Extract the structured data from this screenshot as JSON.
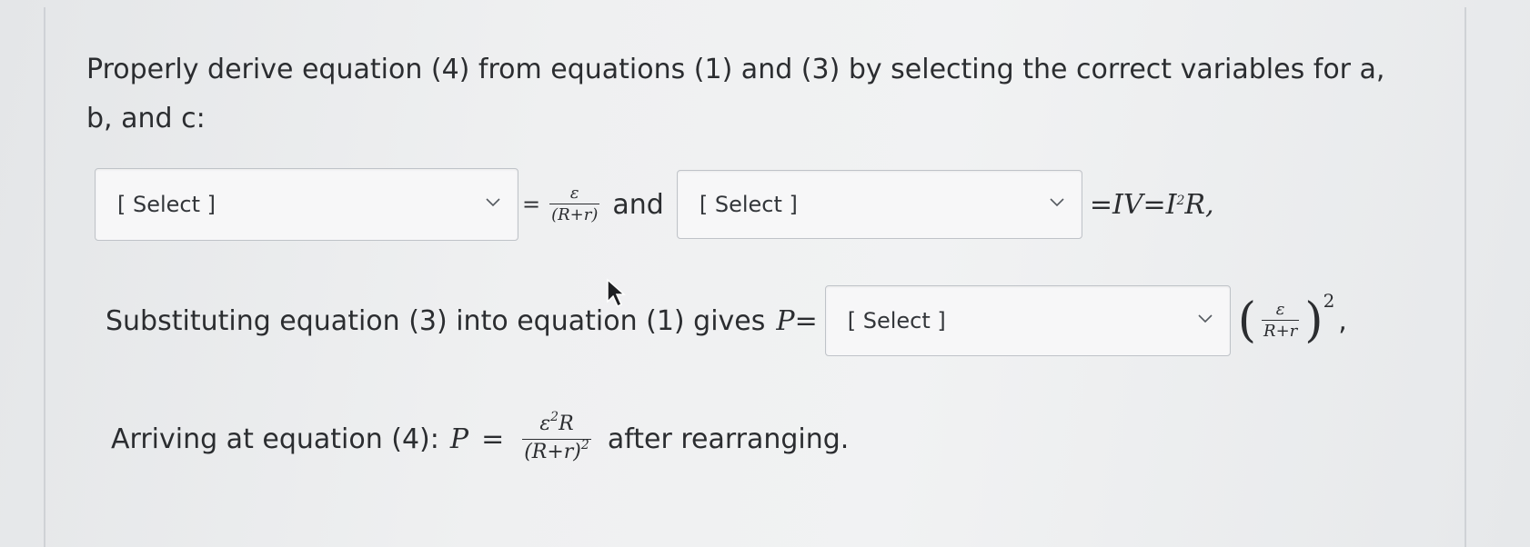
{
  "prompt": {
    "line1": "Properly derive equation (4) from equations (1) and (3) by selecting the correct variables for a,",
    "line2": "b, and c:"
  },
  "row1": {
    "select_a_label": "[ Select ]",
    "equals": "=",
    "frac_num": "ε",
    "frac_den": "(R+r)",
    "and_text": "and",
    "select_b_label": "[ Select ]",
    "tail": "=IV=I",
    "tail_exp": "2",
    "tail_end": "R,"
  },
  "row2": {
    "lead": "Substituting equation (3) into equation (1) gives",
    "lhs": "P=",
    "select_c_label": "[ Select ]",
    "frac_num": "ε",
    "frac_den": "R+r",
    "exponent": "2",
    "comma": ","
  },
  "row3": {
    "lead": "Arriving at equation (4):",
    "lhs": "P",
    "equals": "=",
    "frac_num": "ε",
    "frac_num_exp": "2",
    "frac_num_tail": "R",
    "frac_den": "(R+r)",
    "frac_den_exp": "2",
    "tail": "after rearranging."
  },
  "icons": {
    "dropdown": "chevron-down-icon",
    "cursor": "mouse-pointer-icon"
  }
}
